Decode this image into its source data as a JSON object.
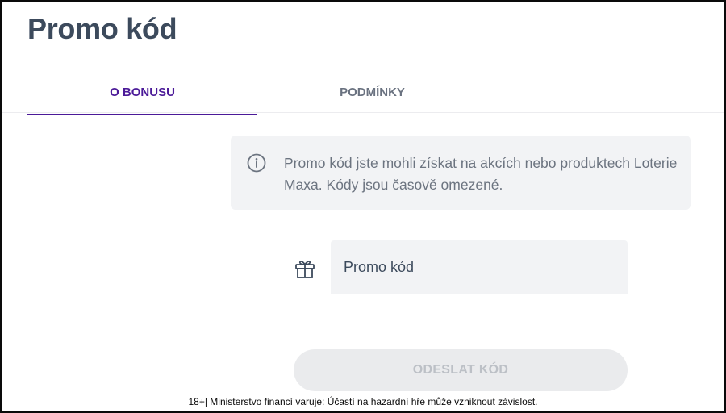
{
  "page": {
    "title": "Promo kód"
  },
  "tabs": [
    {
      "label": "O BONUSU",
      "active": true
    },
    {
      "label": "PODMÍNKY",
      "active": false
    }
  ],
  "info": {
    "icon": "info-icon",
    "text": "Promo kód jste mohli získat na akcích nebo produktech Loterie Maxa. Kódy jsou časově omezené."
  },
  "promo": {
    "icon": "gift-icon",
    "placeholder": "Promo kód",
    "value": ""
  },
  "submit": {
    "label": "ODESLAT KÓD",
    "enabled": false
  },
  "footer": {
    "disclaimer": "18+| Ministerstvo financí varuje: Účastí na hazardní hře může vzniknout závislost."
  },
  "colors": {
    "accent": "#4b1a98",
    "title": "#3c4a5c",
    "info_bg": "#f2f3f5",
    "button_disabled_bg": "#eaebed",
    "button_disabled_text": "#bcc0c6"
  }
}
